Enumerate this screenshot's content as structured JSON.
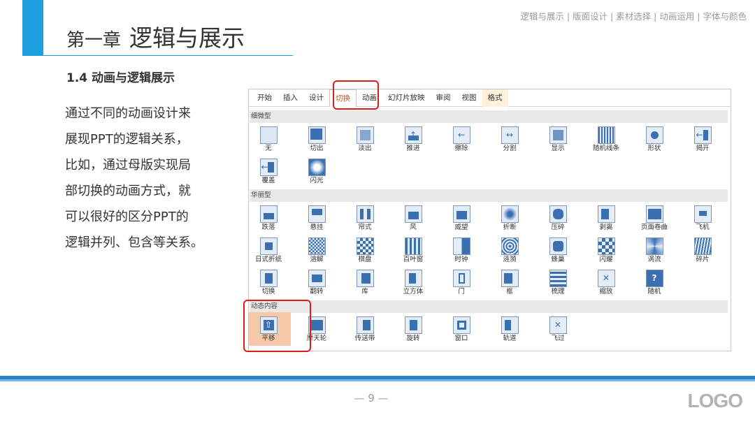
{
  "header": {
    "chapter_number": "第一章",
    "chapter_title": "逻辑与展示",
    "top_nav": "逻辑与展示 | 版面设计 | 素材选择 | 动画运用 | 字体与颜色"
  },
  "section": {
    "title": "1.4 动画与逻辑展示"
  },
  "body": {
    "lines": [
      "通过不同的动画设计来",
      "展现PPT的逻辑关系，",
      "比如，通过母版实现局",
      "部切换的动画方式，就",
      "可以很好的区分PPT的",
      "逻辑并列、包含等关系。"
    ]
  },
  "ribbon": {
    "tabs": [
      "开始",
      "插入",
      "设计",
      "切换",
      "动画",
      "幻灯片放映",
      "审阅",
      "视图",
      "格式"
    ],
    "active_tab": "切换",
    "group_subtle": "细微型",
    "group_exciting": "华丽型",
    "group_dynamic": "动态内容",
    "subtle_row1": [
      "无",
      "切出",
      "淡出",
      "推进",
      "擦除",
      "分割",
      "显示",
      "随机线条",
      "形状",
      "揭开"
    ],
    "subtle_row2": [
      "覆盖",
      "闪光"
    ],
    "exciting_row1": [
      "跌落",
      "悬挂",
      "帘式",
      "风",
      "威望",
      "折断",
      "压碎",
      "剥离",
      "页面卷曲",
      "飞机"
    ],
    "exciting_row2": [
      "日式折纸",
      "溶解",
      "棋盘",
      "百叶窗",
      "时钟",
      "涟漪",
      "蜂巢",
      "闪耀",
      "涡流",
      "碎片"
    ],
    "exciting_row3": [
      "切换",
      "翻转",
      "库",
      "立方体",
      "门",
      "框",
      "梳理",
      "缩放",
      "随机"
    ],
    "dynamic_row": [
      "平移",
      "摩天轮",
      "传送带",
      "旋转",
      "窗口",
      "轨道",
      "飞过"
    ],
    "selected_item": "平移",
    "icon_glyphs": {
      "push": "↑",
      "wipe": "←",
      "split": "↔",
      "uncover": "←",
      "cover": "←",
      "random": "?",
      "pan": "⇧",
      "zoom": "✕",
      "fly": "✕"
    }
  },
  "footer": {
    "page_number": "— 9 —",
    "logo": "LOGO"
  },
  "colors": {
    "accent": "#1ea0e0",
    "highlight": "#e01b1b",
    "selected_fill": "#f9c8a9",
    "icon_blue": "#3a6fb1",
    "bottom_bar": "#2d7fc3"
  }
}
